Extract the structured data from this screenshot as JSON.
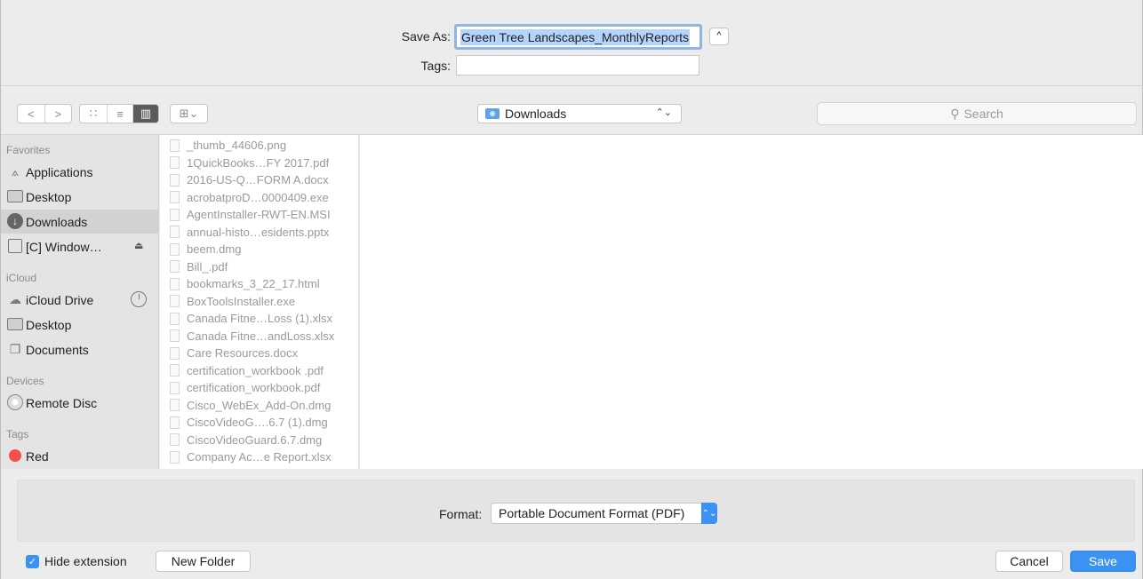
{
  "header": {
    "save_as_label": "Save As:",
    "save_as_value": "Green Tree Landscapes_MonthlyReports",
    "expand_glyph": "^",
    "tags_label": "Tags:",
    "tags_value": ""
  },
  "toolbar": {
    "back_glyph": "<",
    "forward_glyph": ">",
    "icon_view_glyph": "∷",
    "list_view_glyph": "≡",
    "column_view_glyph": "▥",
    "arrange_glyph": "⊞⌄",
    "location": "Downloads",
    "location_arrows": "⌃⌄",
    "search_placeholder": "Search",
    "search_icon": "⚲"
  },
  "sidebar": {
    "sections": [
      {
        "title": "Favorites"
      },
      {
        "title": "iCloud"
      },
      {
        "title": "Devices"
      },
      {
        "title": "Tags"
      }
    ],
    "items": [
      {
        "label": "Applications",
        "icon": "applications-icon"
      },
      {
        "label": "Desktop",
        "icon": "desktop-icon"
      },
      {
        "label": "Downloads",
        "icon": "downloads-icon",
        "selected": true
      },
      {
        "label": "[C] Window…",
        "icon": "drive-icon",
        "eject": "⏏"
      },
      {
        "label": "iCloud Drive",
        "icon": "cloud-icon"
      },
      {
        "label": "Desktop",
        "icon": "desktop-icon"
      },
      {
        "label": "Documents",
        "icon": "documents-icon"
      },
      {
        "label": "Remote Disc",
        "icon": "disc-icon"
      },
      {
        "label": "Red",
        "icon": "red-tag-icon",
        "color": "#f1504c"
      }
    ]
  },
  "files": [
    "_thumb_44606.png",
    "1QuickBooks…FY 2017.pdf",
    "2016-US-Q…FORM A.docx",
    "acrobatproD…0000409.exe",
    "AgentInstaller-RWT-EN.MSI",
    "annual-histo…esidents.pptx",
    "beem.dmg",
    "Bill_.pdf",
    "bookmarks_3_22_17.html",
    "BoxToolsInstaller.exe",
    "Canada Fitne…Loss (1).xlsx",
    "Canada Fitne…andLoss.xlsx",
    "Care Resources.docx",
    "certification_workbook .pdf",
    "certification_workbook.pdf",
    "Cisco_WebEx_Add-On.dmg",
    "CiscoVideoG….6.7 (1).dmg",
    "CiscoVideoGuard.6.7.dmg",
    "Company Ac…e Report.xlsx"
  ],
  "format": {
    "label": "Format:",
    "value": "Portable Document Format (PDF)",
    "stepper_glyph": "⌃⌄"
  },
  "footer": {
    "hide_extension_label": "Hide extension",
    "hide_extension_checked": true,
    "check_glyph": "✓",
    "new_folder_label": "New Folder",
    "cancel_label": "Cancel",
    "save_label": "Save"
  },
  "colors": {
    "accent": "#3b92f2",
    "selection": "#b4d4fd",
    "red_tag": "#f1504c"
  }
}
